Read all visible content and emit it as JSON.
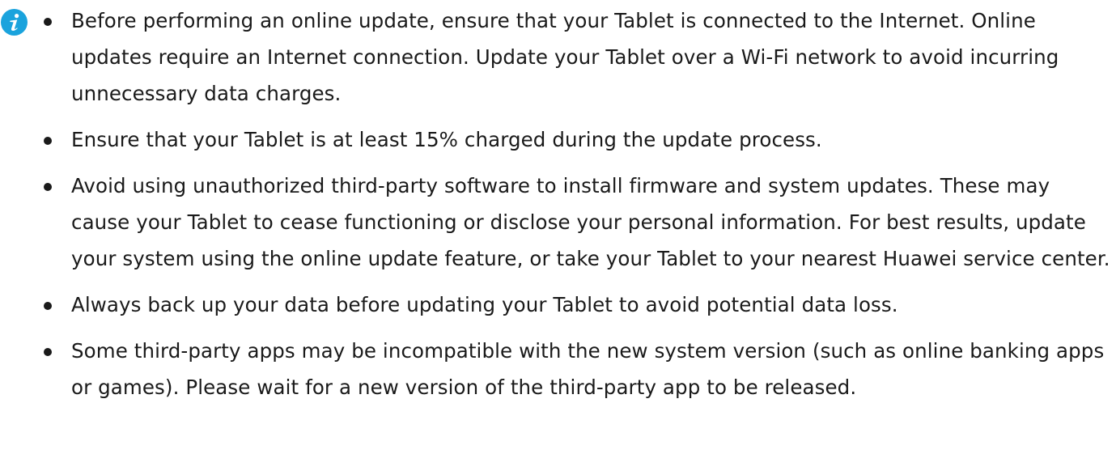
{
  "note": {
    "icon": "info-icon",
    "icon_color": "#1aa3dd",
    "items": [
      "Before performing an online update, ensure that your Tablet is connected to the Internet. Online updates require an Internet connection. Update your Tablet over a Wi-Fi network to avoid incurring unnecessary data charges.",
      "Ensure that your Tablet is at least 15% charged during the update process.",
      "Avoid using unauthorized third-party software to install firmware and system updates. These may cause your Tablet to cease functioning or disclose your personal information. For best results, update your system using the online update feature, or take your Tablet to your nearest Huawei service center.",
      "Always back up your data before updating your Tablet to avoid potential data loss.",
      "Some third-party apps may be incompatible with the new system version (such as online banking apps or games). Please wait for a new version of the third-party app to be released."
    ]
  }
}
